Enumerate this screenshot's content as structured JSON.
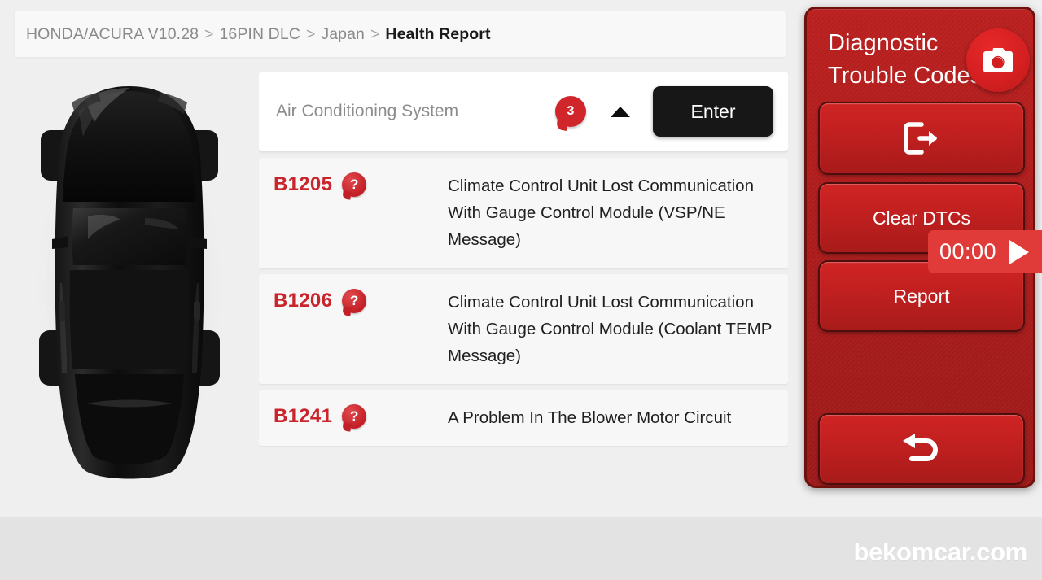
{
  "breadcrumb": {
    "separator": ">",
    "items": [
      {
        "label": "HONDA/ACURA V10.28",
        "current": false
      },
      {
        "label": "16PIN DLC",
        "current": false
      },
      {
        "label": "Japan",
        "current": false
      },
      {
        "label": "Health Report",
        "current": true
      }
    ]
  },
  "vehicle_image": {
    "alt": "black car top view",
    "body_color": "#0b0b0b"
  },
  "system_header": {
    "name": "Air Conditioning System",
    "dtc_count": "3",
    "caret_icon": "caret-up-icon",
    "enter_label": "Enter"
  },
  "dtc_list": [
    {
      "code": "B1205",
      "help_icon": "?",
      "description": "Climate Control Unit Lost Communication With Gauge Control Module (VSP/NE Message)"
    },
    {
      "code": "B1206",
      "help_icon": "?",
      "description": "Climate Control Unit Lost Communication With Gauge Control Module (Coolant TEMP Message)"
    },
    {
      "code": "B1241",
      "help_icon": "?",
      "description": "A Problem In The Blower Motor Circuit"
    }
  ],
  "right_panel": {
    "title": "Diagnostic Trouble Codes",
    "camera_icon": "camera-icon",
    "buttons": [
      {
        "id": "exit",
        "label": "",
        "icon": "exit-icon"
      },
      {
        "id": "clear",
        "label": "Clear DTCs",
        "icon": ""
      },
      {
        "id": "report",
        "label": "Report",
        "icon": ""
      },
      {
        "id": "back",
        "label": "",
        "icon": "back-arrow-icon"
      }
    ]
  },
  "timer": {
    "value": "00:00",
    "play_icon": "play-icon"
  },
  "watermark": {
    "text": "bekomcar.com"
  },
  "colors": {
    "panel_red": "#a91c1c",
    "accent_red": "#c9252c",
    "badge_red": "#d0262b",
    "timer_red": "#e03b38",
    "enter_black": "#171717",
    "page_bg": "#efefef",
    "bottom_bg": "#e3e3e3"
  }
}
